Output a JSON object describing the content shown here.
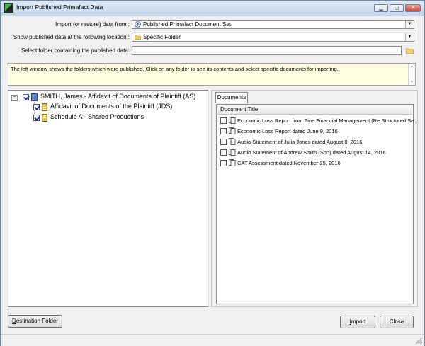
{
  "window": {
    "title": "Import Published Primafact Data"
  },
  "form": {
    "import_from_label": "Import (or restore) data from :",
    "import_from_value": "Published Primafact Document Set",
    "location_label": "Show published data at the following location :",
    "location_value": "Specific Folder",
    "folder_label": "Select folder containing the published data:",
    "folder_value": ""
  },
  "info": {
    "text": "The left window shows the folders which were published.  Click on any folder to see its contents and select specific documents for importing."
  },
  "tree": {
    "root": {
      "label": "SMITH, James - Affidavit of Documents of Plaintiff (AS)",
      "expander": "−"
    },
    "children": [
      {
        "label": "Affidavit of Documents of the Plaintiff (JDS)"
      },
      {
        "label": "Schedule A - Shared Productions"
      }
    ]
  },
  "documents": {
    "tab_label": "Documents",
    "column_header": "Document Title",
    "rows": [
      {
        "title": "Economic Loss Report from Fine Financial Management (Re Structured Se..."
      },
      {
        "title": "Economic Loss Report dated June 9, 2016"
      },
      {
        "title": "Audio Statement of Julia Jones dated August 8, 2016"
      },
      {
        "title": "Audio Statement of Andrew Smith (Son) dated August 14, 2016"
      },
      {
        "title": "CAT Assessment dated November 25, 2016"
      }
    ]
  },
  "buttons": {
    "destination_first": "D",
    "destination_rest": "estination Folder",
    "import_first": "I",
    "import_rest": "mport",
    "close_label": "Close"
  },
  "colors": {
    "accent": "#1b2fb0",
    "info_bg": "#ffffe1"
  }
}
